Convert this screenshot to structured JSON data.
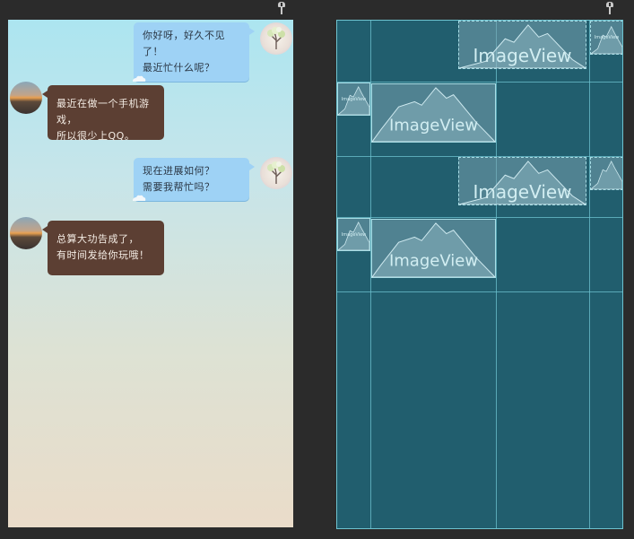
{
  "chat": {
    "messages": [
      {
        "direction": "outgoing",
        "avatar": "tree-blossom-avatar",
        "lines": [
          "你好呀，好久不见了！",
          "最近忙什么呢？"
        ]
      },
      {
        "direction": "incoming",
        "avatar": "sunset-avatar",
        "lines": [
          "最近在做一个手机游戏，",
          "所以很少上QQ。"
        ]
      },
      {
        "direction": "outgoing",
        "avatar": "tree-blossom-avatar",
        "lines": [
          "现在进展如何？",
          "需要我帮忙吗？"
        ]
      },
      {
        "direction": "incoming",
        "avatar": "sunset-avatar",
        "lines": [
          "总算大功告成了，",
          "有时间发给你玩哦！"
        ]
      }
    ]
  },
  "blueprint": {
    "imageview_label": "ImageView"
  },
  "colors": {
    "editor_background": "#2b2b2b",
    "blueprint_background": "#215e6e",
    "blueprint_outline": "#6ec3d0",
    "outgoing_bubble": "#9ed2f5",
    "incoming_bubble": "#5c3f33"
  },
  "icons": {
    "pin_left": "pin-icon",
    "pin_right": "pin-icon"
  }
}
